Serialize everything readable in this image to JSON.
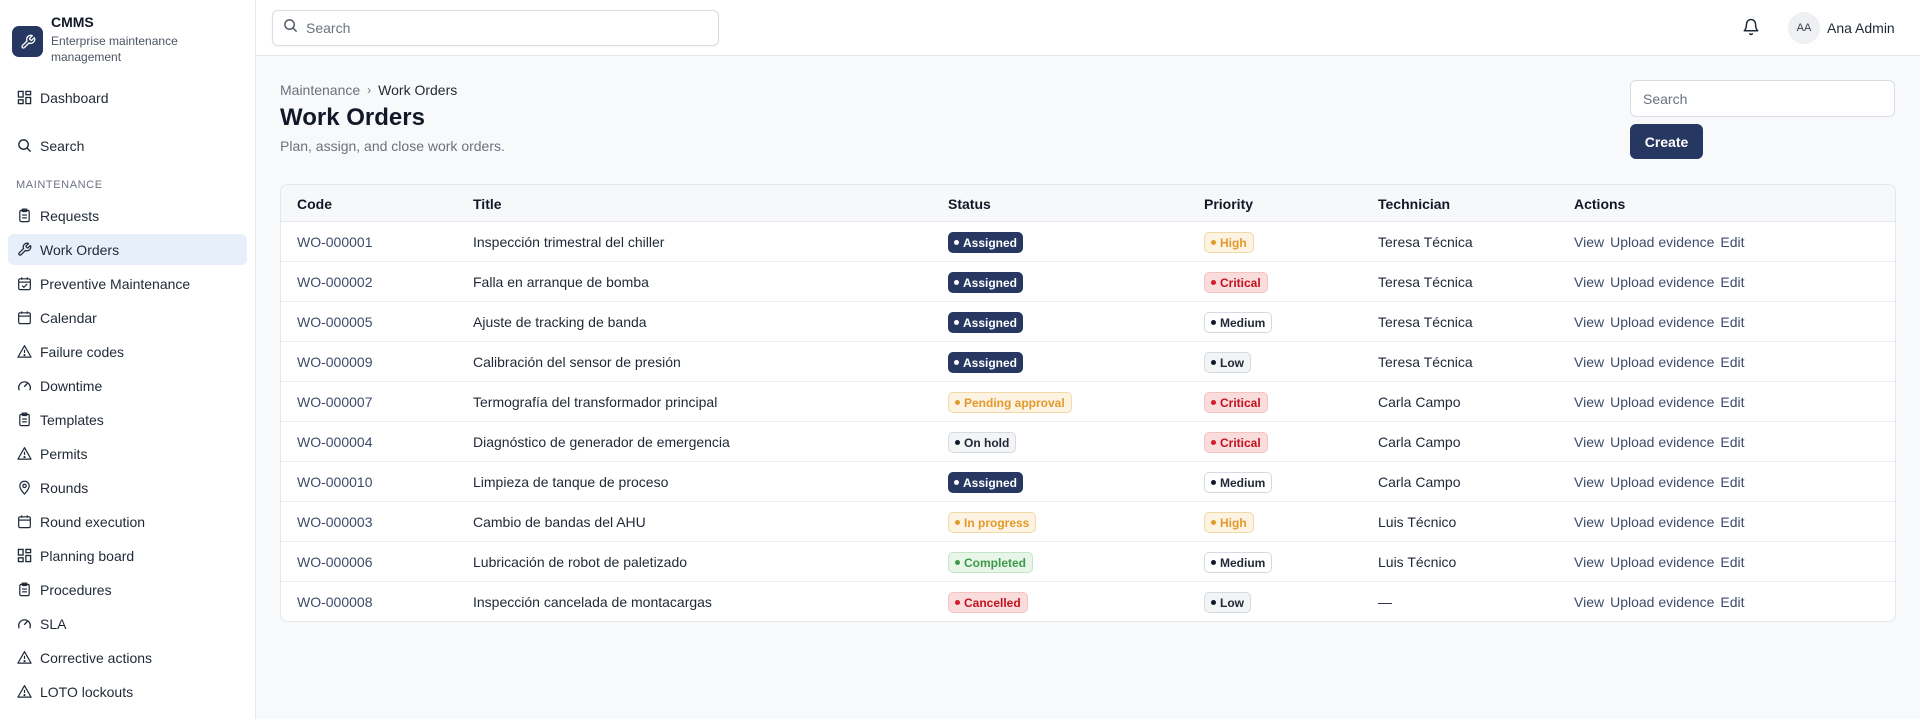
{
  "brand": {
    "title": "CMMS",
    "subtitle": "Enterprise maintenance management"
  },
  "sidebar": {
    "dashboard": "Dashboard",
    "search": "Search",
    "section_label": "MAINTENANCE",
    "items": [
      {
        "label": "Requests",
        "icon": "clipboard-icon"
      },
      {
        "label": "Work Orders",
        "icon": "wrench-icon",
        "active": true
      },
      {
        "label": "Preventive Maintenance",
        "icon": "calendar-check-icon"
      },
      {
        "label": "Calendar",
        "icon": "calendar-icon"
      },
      {
        "label": "Failure codes",
        "icon": "warning-triangle-icon"
      },
      {
        "label": "Downtime",
        "icon": "gauge-icon"
      },
      {
        "label": "Templates",
        "icon": "clipboard-icon"
      },
      {
        "label": "Permits",
        "icon": "warning-triangle-icon"
      },
      {
        "label": "Rounds",
        "icon": "map-pin-icon"
      },
      {
        "label": "Round execution",
        "icon": "calendar-icon"
      },
      {
        "label": "Planning board",
        "icon": "grid-icon"
      },
      {
        "label": "Procedures",
        "icon": "clipboard-icon"
      },
      {
        "label": "SLA",
        "icon": "gauge-icon"
      },
      {
        "label": "Corrective actions",
        "icon": "warning-triangle-icon"
      },
      {
        "label": "LOTO lockouts",
        "icon": "warning-triangle-icon"
      }
    ]
  },
  "topbar": {
    "search_placeholder": "Search",
    "user_initials": "AA",
    "user_name": "Ana Admin"
  },
  "page": {
    "breadcrumb": [
      "Maintenance",
      "Work Orders"
    ],
    "title": "Work Orders",
    "subtitle": "Plan, assign, and close work orders.",
    "search_placeholder": "Search",
    "create_label": "Create"
  },
  "table": {
    "columns": [
      "Code",
      "Title",
      "Status",
      "Priority",
      "Technician",
      "Actions"
    ],
    "action_labels": [
      "View",
      "Upload evidence",
      "Edit"
    ],
    "rows": [
      {
        "code": "WO-000001",
        "title": "Inspección trimestral del chiller",
        "status": "Assigned",
        "priority": "High",
        "technician": "Teresa Técnica"
      },
      {
        "code": "WO-000002",
        "title": "Falla en arranque de bomba",
        "status": "Assigned",
        "priority": "Critical",
        "technician": "Teresa Técnica"
      },
      {
        "code": "WO-000005",
        "title": "Ajuste de tracking de banda",
        "status": "Assigned",
        "priority": "Medium",
        "technician": "Teresa Técnica"
      },
      {
        "code": "WO-000009",
        "title": "Calibración del sensor de presión",
        "status": "Assigned",
        "priority": "Low",
        "technician": "Teresa Técnica"
      },
      {
        "code": "WO-000007",
        "title": "Termografía del transformador principal",
        "status": "Pending approval",
        "priority": "Critical",
        "technician": "Carla Campo"
      },
      {
        "code": "WO-000004",
        "title": "Diagnóstico de generador de emergencia",
        "status": "On hold",
        "priority": "Critical",
        "technician": "Carla Campo"
      },
      {
        "code": "WO-000010",
        "title": "Limpieza de tanque de proceso",
        "status": "Assigned",
        "priority": "Medium",
        "technician": "Carla Campo"
      },
      {
        "code": "WO-000003",
        "title": "Cambio de bandas del AHU",
        "status": "In progress",
        "priority": "High",
        "technician": "Luis Técnico"
      },
      {
        "code": "WO-000006",
        "title": "Lubricación de robot de paletizado",
        "status": "Completed",
        "priority": "Medium",
        "technician": "Luis Técnico"
      },
      {
        "code": "WO-000008",
        "title": "Inspección cancelada de montacargas",
        "status": "Cancelled",
        "priority": "Low",
        "technician": "—"
      }
    ]
  },
  "colors": {
    "brand": "#263761",
    "active_nav": "#e6effa",
    "high": "#e29a2b",
    "critical": "#c1121f",
    "completed": "#3c9a4a"
  }
}
